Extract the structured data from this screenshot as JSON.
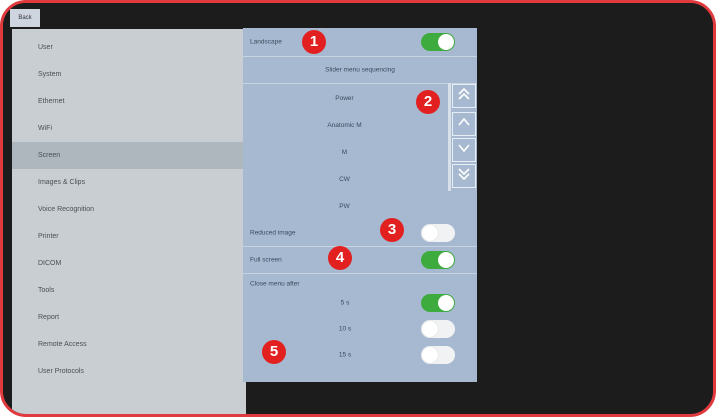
{
  "top_bar": {
    "back_label": "Back"
  },
  "sidebar": {
    "items": [
      {
        "label": "User"
      },
      {
        "label": "System"
      },
      {
        "label": "Ethernet"
      },
      {
        "label": "WiFi"
      },
      {
        "label": "Screen",
        "active": true
      },
      {
        "label": "Images & Clips"
      },
      {
        "label": "Voice Recognition"
      },
      {
        "label": "Printer"
      },
      {
        "label": "DICOM"
      },
      {
        "label": "Tools"
      },
      {
        "label": "Report"
      },
      {
        "label": "Remote Access"
      },
      {
        "label": "User Protocols"
      }
    ]
  },
  "screen_panel": {
    "landscape": {
      "label": "Landscape",
      "state": "on"
    },
    "slider_menu_header": "Slider menu sequencing",
    "slider_items": [
      "Power",
      "Anatomic M",
      "M",
      "CW",
      "PW"
    ],
    "reduced_image": {
      "label": "Reduced image",
      "state": "off"
    },
    "full_screen": {
      "label": "Full screen",
      "state": "on"
    },
    "close_menu_after": {
      "label": "Close menu after",
      "options": [
        {
          "label": "5 s",
          "state": "on"
        },
        {
          "label": "10 s",
          "state": "off"
        },
        {
          "label": "15 s",
          "state": "off"
        }
      ]
    }
  },
  "scroll_buttons": {
    "top_icon": "double-up-chevron",
    "up_icon": "up-chevron",
    "down_icon": "down-chevron",
    "bottom_icon": "double-down-chevron"
  },
  "callouts": [
    "1",
    "2",
    "3",
    "4",
    "5"
  ],
  "colors": {
    "frame": "#e03a3e",
    "toggle_on": "#3dab3d",
    "panel": "#a6b9d1",
    "sidebar": "#c9ced3",
    "callout": "#e32020"
  }
}
